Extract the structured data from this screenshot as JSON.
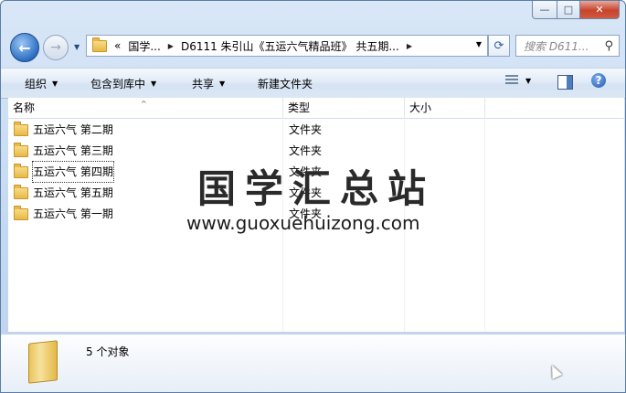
{
  "window": {
    "caption_buttons": {
      "minimize": "—",
      "maximize": "□",
      "close": "✕"
    }
  },
  "nav": {
    "address": {
      "breadcrumbs": [
        "«",
        "国学...",
        "D6111 朱引山《五运六气精品班》 共五期..."
      ]
    },
    "search": {
      "placeholder": "搜索 D611..."
    }
  },
  "toolbar": {
    "organize": "组织",
    "include_in_library": "包含到库中",
    "share": "共享",
    "new_folder": "新建文件夹"
  },
  "list": {
    "columns": {
      "name": "名称",
      "type": "类型",
      "size": "大小"
    },
    "rows": [
      {
        "name": "五运六气 第二期",
        "type": "文件夹"
      },
      {
        "name": "五运六气 第三期",
        "type": "文件夹"
      },
      {
        "name": "五运六气 第四期",
        "type": "文件夹"
      },
      {
        "name": "五运六气 第五期",
        "type": "文件夹"
      },
      {
        "name": "五运六气 第一期",
        "type": "文件夹"
      }
    ]
  },
  "watermark": {
    "title": "国学汇总站",
    "url": "www.guoxuehuizong.com"
  },
  "details": {
    "item_count": "5 个对象"
  },
  "icons": {
    "back": "back-arrow-icon",
    "forward": "forward-arrow-icon",
    "folder": "folder-icon",
    "refresh": "refresh-icon",
    "search": "magnifier-icon",
    "help": "help-icon"
  }
}
